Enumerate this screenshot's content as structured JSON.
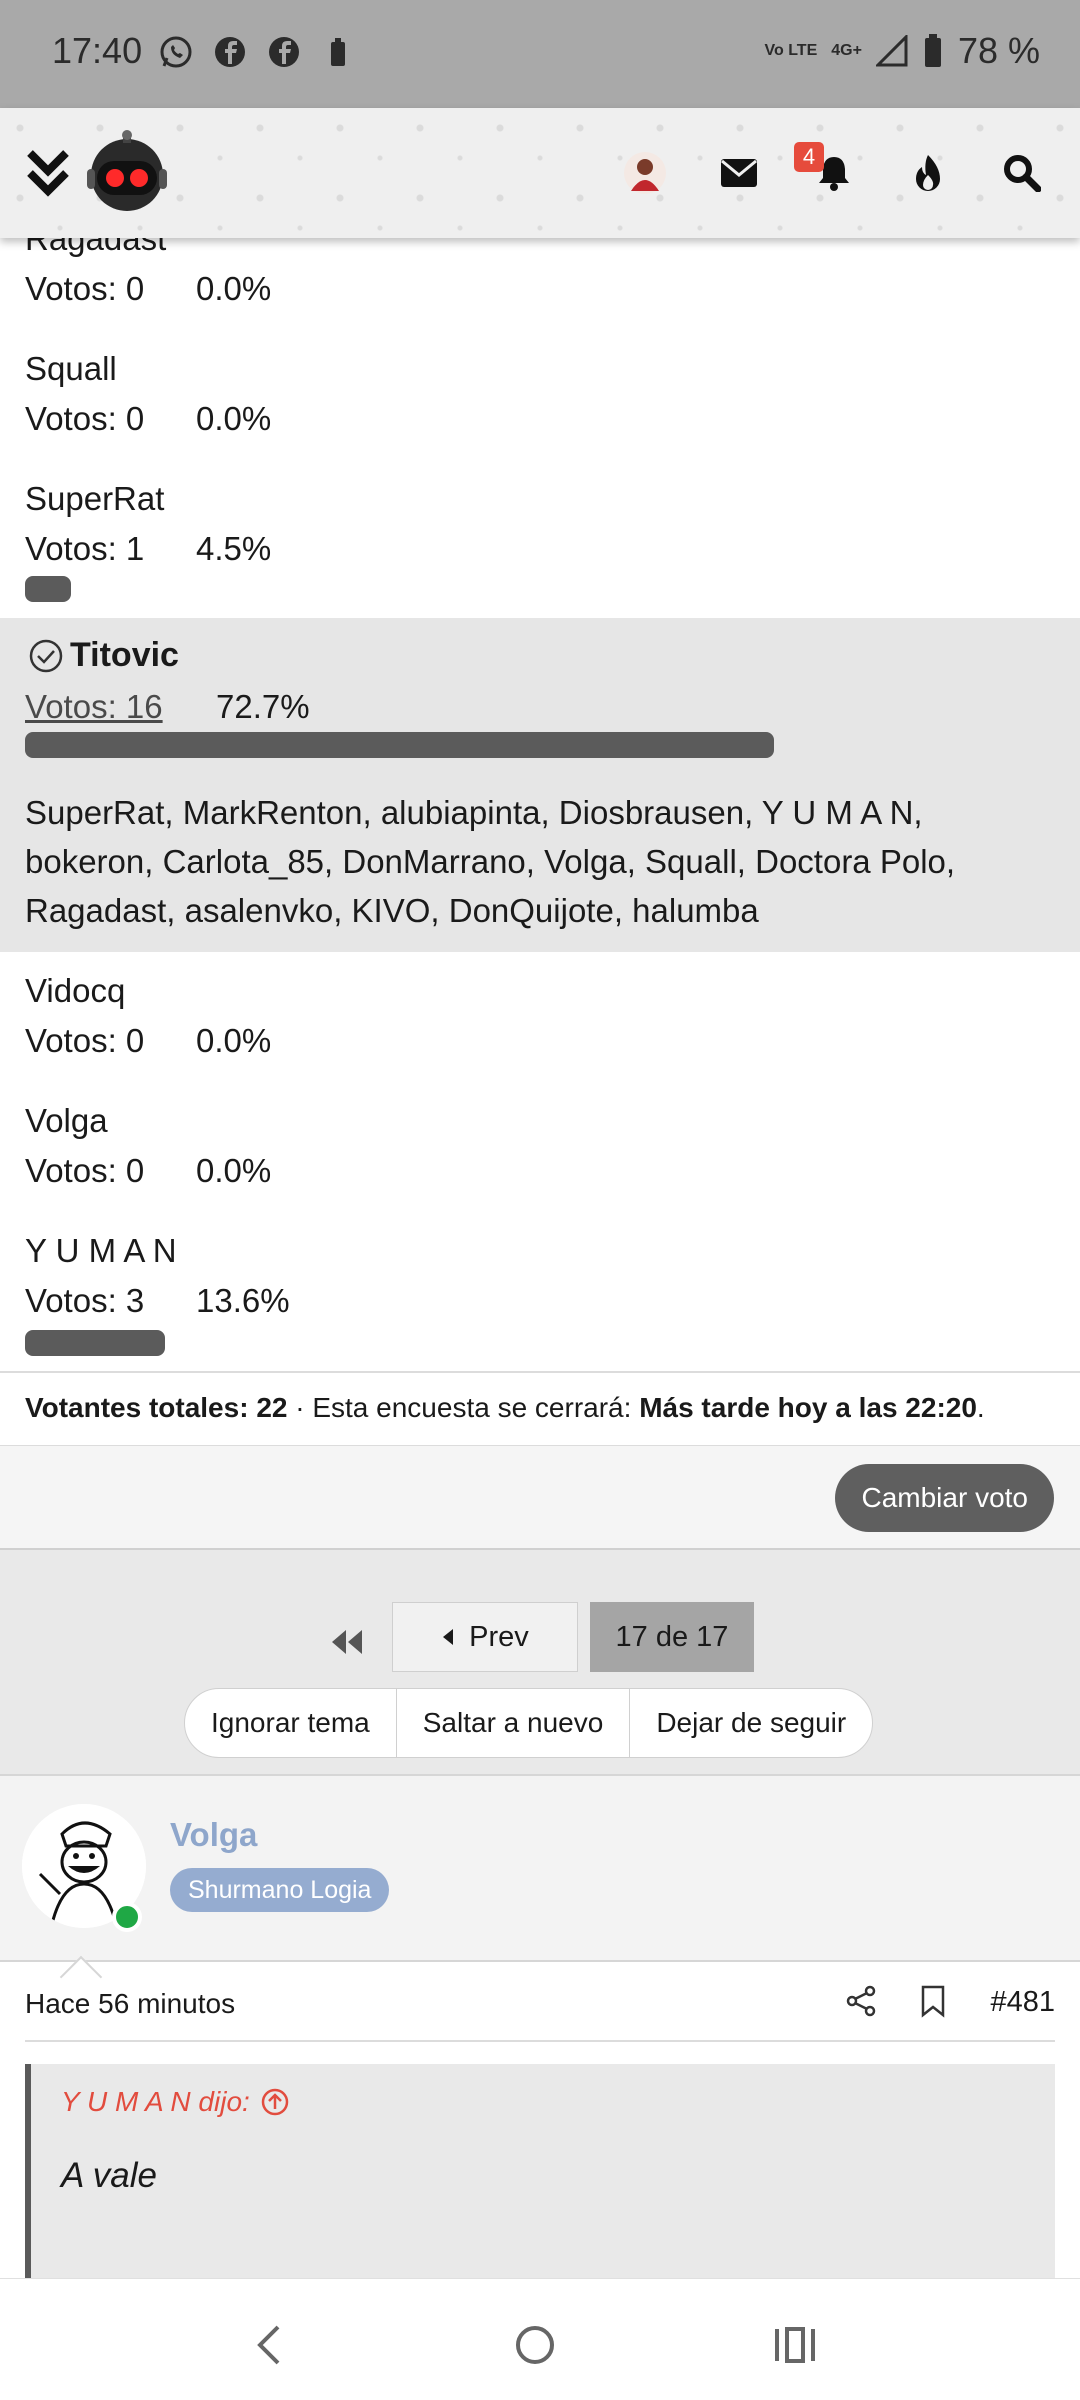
{
  "status_bar": {
    "time": "17:40",
    "network_top": "Vo LTE",
    "network_type": "4G+",
    "battery": "78 %"
  },
  "header": {
    "notification_count": "4"
  },
  "poll": {
    "partial_top": "Ragadast",
    "options": [
      {
        "name": "Ragadast",
        "votes_label": "Votos: 0",
        "percent": "0.0%",
        "share": 0.0
      },
      {
        "name": "Squall",
        "votes_label": "Votos: 0",
        "percent": "0.0%",
        "share": 0.0
      },
      {
        "name": "SuperRat",
        "votes_label": "Votos: 1",
        "percent": "4.5%",
        "share": 0.045
      },
      {
        "name": "Titovic",
        "votes_label": "Votos: 16",
        "percent": "72.7%",
        "share": 0.727
      },
      {
        "name": "Vidocq",
        "votes_label": "Votos: 0",
        "percent": "0.0%",
        "share": 0.0
      },
      {
        "name": "Volga",
        "votes_label": "Votos: 0",
        "percent": "0.0%",
        "share": 0.0
      },
      {
        "name": "Y U M A N",
        "votes_label": "Votos: 3",
        "percent": "13.6%",
        "share": 0.136
      }
    ],
    "winner_voters": "SuperRat, MarkRenton, alubiapinta, Diosbrausen, Y U M A N, bokeron, Carlota_85, DonMarrano, Volga, Squall, Doctora Polo, Ragadast, asalenvko, KIVO, DonQuijote, halumba",
    "summary": {
      "total_label": "Votantes totales:",
      "total_value": "22",
      "close_label": "· Esta encuesta se cerrará:",
      "close_value": "Más tarde hoy a las 22:20",
      "period": "."
    },
    "change_vote": "Cambiar voto"
  },
  "pagination": {
    "prev": "Prev",
    "current": "17 de 17"
  },
  "thread_actions": [
    "Ignorar tema",
    "Saltar a nuevo",
    "Dejar de seguir"
  ],
  "post": {
    "author": "Volga",
    "rank": "Shurmano Logia",
    "time": "Hace 56 minutos",
    "number": "#481",
    "quote_author": "Y U M A N dijo:",
    "quote_text": "A vale"
  },
  "colors": {
    "bar": "#5b5b5b",
    "highlight_bg": "#e6e6e6",
    "user_name": "#8ea6cb",
    "rank_badge": "#95acd0",
    "quote_author": "#e24c3e",
    "badge": "#e64b3c",
    "online": "#1fa845"
  }
}
